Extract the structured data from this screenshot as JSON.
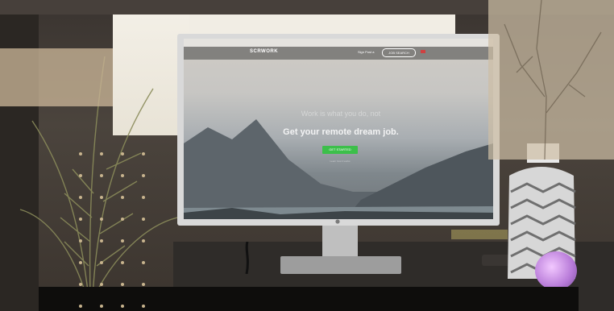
{
  "photo": {
    "subject": "Desktop monitor on a desk displaying a remote-jobs website",
    "screen": {
      "logo": "SCRWORK",
      "nav_links": "Sign   Post a",
      "nav_button": "JOB SEARCH",
      "headline": "Work is what you do, not",
      "subheadline": "Get your remote dream job.",
      "cta": "GET STARTED",
      "cta_sublink": "Learn how it works"
    }
  },
  "colors": {
    "overlay_tan": "#cbb492",
    "cta_green": "#3cbf4a",
    "stone_purple": "#b77ad8"
  }
}
